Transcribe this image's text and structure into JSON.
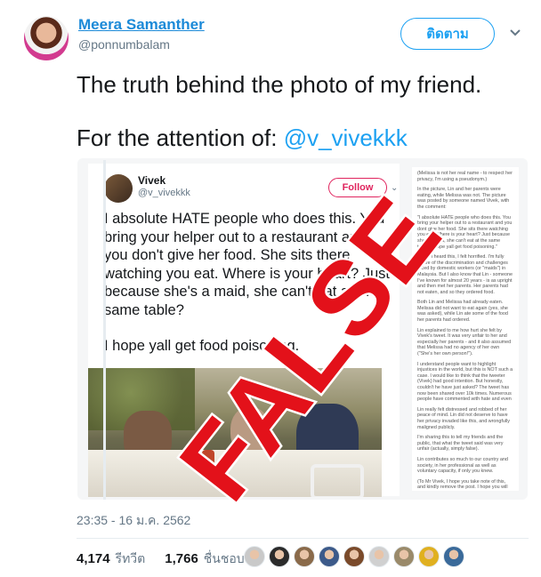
{
  "author": {
    "name": "Meera Samanther",
    "handle": "@ponnumbalam",
    "follow_label": "ติดตาม"
  },
  "tweet": {
    "line1": "The truth behind the photo of my friend.",
    "line2_prefix": "For the attention of: ",
    "mention": "@v_vivekkk",
    "timestamp": "23:35 - 16 ม.ค. 2562"
  },
  "embedded": {
    "name": "Vivek",
    "handle": "@v_vivekkk",
    "follow_label": "Follow",
    "text_p1": "I absolute HATE people who does this. You bring your helper out to a restaurant and you don't give her food. She sits there watching you eat. Where is your heart? Just because she's a maid, she can't eat at the same table?",
    "text_p2": "I hope yall get food poisoning.",
    "side_paragraphs": [
      "(Melissa is not her real name - to respect her privacy, I'm using a pseudonym.)",
      "In the picture, Lin and her parents were eating, while Melissa was not. The picture was posted by someone named Vivek, with the comment:",
      "\"I absolute HATE people who does this. You bring your helper out to a restaurant and you dont give her food. She sits there watching you eat. Where is your heart? Just because she's a maid, she can't eat at the same table? I hope yall get food poisoning.\"",
      "When I heard this, I felt horrified. I'm fully aware of the discrimination and challenges faced by domestic workers (or \"maids\") in Malaysia. But I also know that Lin - someone I've known for almost 20 years - is as upright and then met her parents. Her parents had not eaten, and so they ordered food.",
      "Both Lin and Melissa had already eaten. Melissa did not want to eat again (yes, she was asked), while Lin ate some of the food her parents had ordered.",
      "Lin explained to me how hurt she felt by Vivek's tweet. It was very unfair to her and especially her parents - and it also assumed that Melissa had no agency of her own (\"She's her own person!\").",
      "I understand people want to highlight injustices in the world, but this is NOT such a case. I would like to think that the tweeter (Vivek) had good intention. But honestly, couldn't he have just asked? The tweet has now been shared over 10k times. Numerous people have commented with hate and even",
      "Lin really felt distressed and robbed of her peace of mind. Lin did not deserve to have her privacy invaded like this, and wrongfully maligned publicly.",
      "I'm sharing this to tell my friends and the public, that what the tweet said was very unfair (actually, simply false).",
      "Lin contributes so much to our country and society, in her professional as well as voluntary capacity, if only you knew.",
      "(To Mr Vivek, I hope you take note of this, and kindly remove the post. I hope you will offer some kind of public retraction and apology to my friend, her parents, and Melissa. I'd be happy to speak to you personally. Thanks)"
    ]
  },
  "stamp": {
    "word": "FALSE",
    "color": "#e3111a"
  },
  "stats": {
    "retweets_count": "4,174",
    "retweets_label": "รีทวีต",
    "likes_count": "1,766",
    "likes_label": "ชื่นชอบ"
  },
  "likers": [
    "#c9c9c9",
    "#2b2b2b",
    "#8a6a4a",
    "#3c5a8a",
    "#7a4a2a",
    "#d0d0d0",
    "#9a8a6a",
    "#e0b020",
    "#3a6a9a"
  ],
  "colors": {
    "link": "#1da1f2",
    "name": "#1c8ad8",
    "muted": "#657786",
    "follow_red": "#e0245e"
  }
}
